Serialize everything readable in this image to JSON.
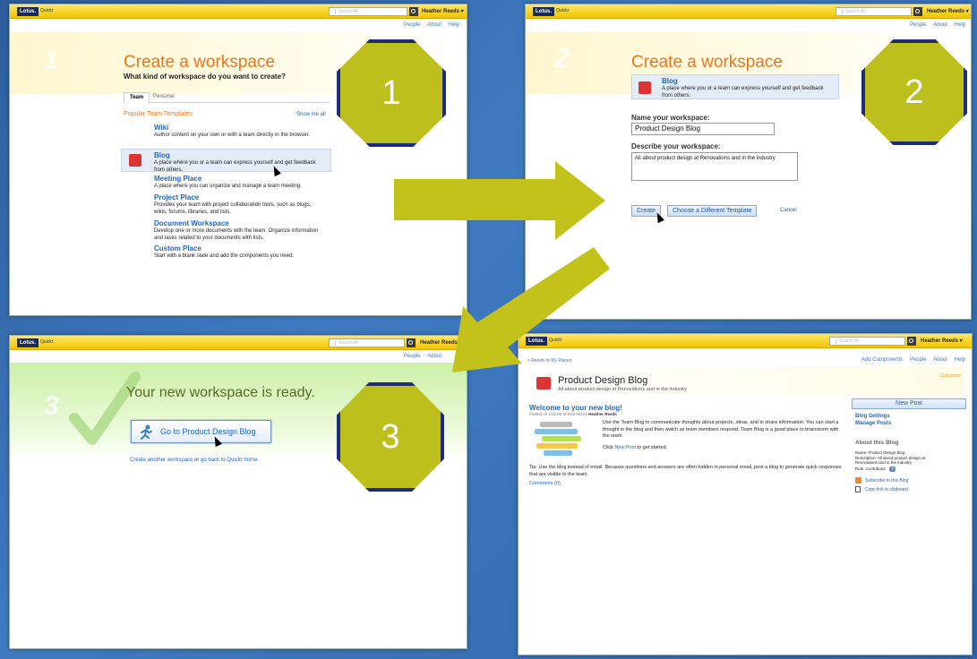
{
  "common": {
    "logo": "Lotus.",
    "appname": "Quickr",
    "search_placeholder": "Search All",
    "user": "Heather Reeds ▾",
    "nav": [
      "People",
      "About",
      "Help"
    ]
  },
  "panel1": {
    "step": "1",
    "title": "Create a workspace",
    "subtitle": "What kind of workspace do you want to create?",
    "tabs": [
      "Team",
      "Personal"
    ],
    "section": "Popular Team Templates:",
    "show_more": "Show me all",
    "templates": [
      {
        "name": "Wiki",
        "desc": "Author content on your own or with a team directly in the browser."
      },
      {
        "name": "Blog",
        "desc": "A place where you or a team can express yourself and get feedback from others."
      },
      {
        "name": "Meeting Place",
        "desc": "A place where you can organize and manage a team meeting."
      },
      {
        "name": "Project Place",
        "desc": "Provides your team with project collaboration tools, such as blogs, wikis, forums, libraries, and lists."
      },
      {
        "name": "Document Workspace",
        "desc": "Develop one or more documents with the team. Organize information and tasks related to your documents with lists."
      },
      {
        "name": "Custom Place",
        "desc": "Start with a blank slate and add the components you need."
      }
    ]
  },
  "panel2": {
    "step": "2",
    "title": "Create a workspace",
    "template_name": "Blog",
    "template_desc": "A place where you or a team can express yourself and get feedback from others.",
    "name_label": "Name your workspace:",
    "name_value": "Product Design Blog",
    "desc_label": "Describe your workspace:",
    "desc_value": "All about product design at Renovations and in the industry",
    "create": "Create",
    "choose": "Choose a Different Template",
    "cancel": "Cancel"
  },
  "panel3": {
    "step": "3",
    "heading": "Your new workspace is ready.",
    "goto": "Go to Product Design Blog",
    "links_pre": "Create another workspace",
    "links_or": " or ",
    "links_post": "go back to Quickr home."
  },
  "panel4": {
    "return": "< Return to My Places",
    "nav": [
      "Add Components",
      "People",
      "About",
      "Help"
    ],
    "customize": "Customize",
    "blog_title": "Product Design Blog",
    "blog_sub": "All about product design at Renovations and in the industry",
    "welcome": "Welcome to your new blog!",
    "posted_pre": "Posted on 1/11/08 at 6:02 AM by ",
    "posted_by": "Heather Reeds",
    "body1": "Use the Team Blog to communicate thoughts about projects, ideas, and to share information. You can start a thought in the blog and then watch as team members respond. Team Blog is a good place to brainstorm with the team.",
    "click_pre": "Click ",
    "click_link": "New Post",
    "click_post": " to get started.",
    "tip": "Tip: Use the blog instead of email. Because questions and answers are often hidden in personal email, post a blog to generate quick responses that are visible to the team.",
    "comments": "Comments (0)",
    "new_post": "New Post",
    "blog_settings": "Blog Settings",
    "manage_posts": "Manage Posts",
    "about_title": "About this Blog",
    "about_name": "Name: Product Design Blog",
    "about_desc": "Description: All about product design at Renovations and in the industry",
    "about_role": "Role: Contributor",
    "subscribe": "Subscribe to this Blog",
    "copy_link": "Copy link to clipboard"
  },
  "colors": {
    "octagon": "#bdbf1c",
    "octagon_border": "#1e2a7a",
    "arrow": "#c3c21b",
    "accent_orange": "#e8761a",
    "link_blue": "#2266bb"
  }
}
